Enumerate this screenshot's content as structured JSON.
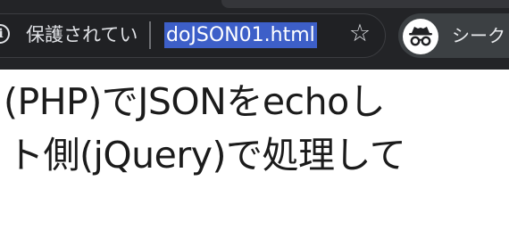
{
  "browser": {
    "security_label": "保護されてい",
    "url": "doJSON01.html",
    "incognito_label": "シーク",
    "icons": {
      "site_info": "info-icon",
      "bookmark": "star-icon",
      "incognito": "incognito-icon"
    },
    "colors": {
      "toolbar_bg": "#232427",
      "url_highlight": "#3d5fc8"
    }
  },
  "page": {
    "line1": "(PHP)でJSONをechoし",
    "line2": "ト側(jQuery)で処理して"
  }
}
